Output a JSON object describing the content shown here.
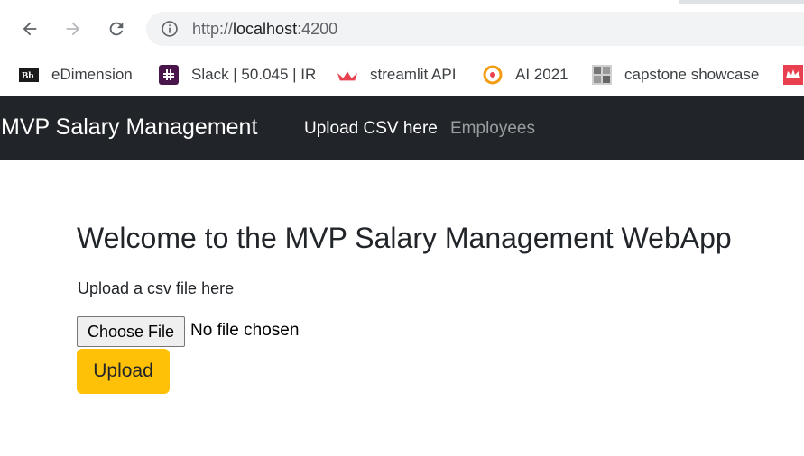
{
  "browser": {
    "url_scheme": "http://",
    "url_host": "localhost",
    "url_port": ":4200",
    "bookmarks": [
      {
        "label": "eDimension",
        "icon": "blackboard-icon"
      },
      {
        "label": "Slack | 50.045 | IR",
        "icon": "slack-icon"
      },
      {
        "label": "streamlit API",
        "icon": "streamlit-icon"
      },
      {
        "label": "AI 2021",
        "icon": "ai-icon"
      },
      {
        "label": "capstone showcase",
        "icon": "showcase-icon"
      }
    ]
  },
  "navbar": {
    "brand": "MVP Salary Management",
    "links": [
      {
        "label": "Upload CSV here",
        "active": true
      },
      {
        "label": "Employees",
        "active": false
      }
    ]
  },
  "main": {
    "heading": "Welcome to the MVP Salary Management WebApp",
    "upload_label": "Upload a csv file here",
    "file_button_label": "Choose File",
    "file_status": "No file chosen",
    "upload_button_label": "Upload"
  },
  "colors": {
    "navbar_bg": "#212529",
    "upload_button": "#ffc107",
    "muted_link": "#9a9da0"
  }
}
